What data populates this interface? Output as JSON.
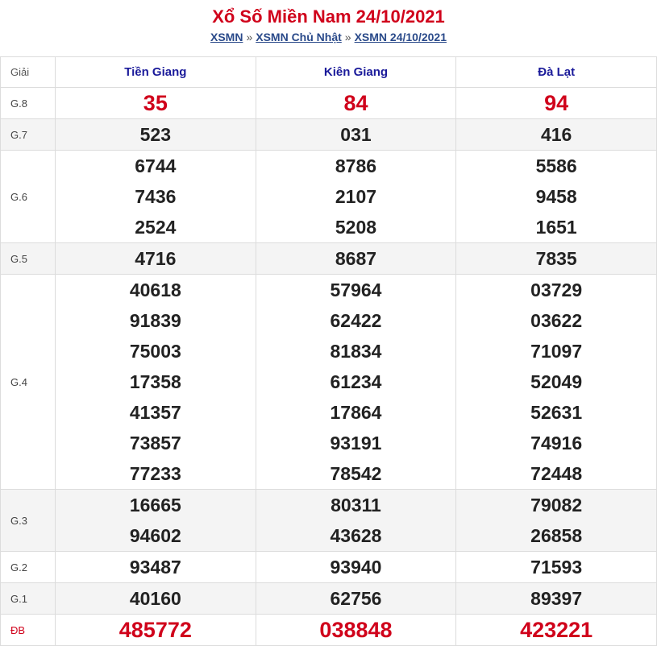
{
  "title": "Xổ Số Miền Nam 24/10/2021",
  "breadcrumb": {
    "items": [
      "XSMN",
      "XSMN Chủ Nhật",
      "XSMN 24/10/2021"
    ],
    "separator": "»"
  },
  "header": {
    "prize_col": "Giải",
    "provinces": [
      "Tiền Giang",
      "Kiên Giang",
      "Đà Lạt"
    ]
  },
  "rows": {
    "g8": {
      "label": "G.8",
      "values": [
        [
          "35"
        ],
        [
          "84"
        ],
        [
          "94"
        ]
      ]
    },
    "g7": {
      "label": "G.7",
      "values": [
        [
          "523"
        ],
        [
          "031"
        ],
        [
          "416"
        ]
      ]
    },
    "g6": {
      "label": "G.6",
      "values": [
        [
          "6744",
          "7436",
          "2524"
        ],
        [
          "8786",
          "2107",
          "5208"
        ],
        [
          "5586",
          "9458",
          "1651"
        ]
      ]
    },
    "g5": {
      "label": "G.5",
      "values": [
        [
          "4716"
        ],
        [
          "8687"
        ],
        [
          "7835"
        ]
      ]
    },
    "g4": {
      "label": "G.4",
      "values": [
        [
          "40618",
          "91839",
          "75003",
          "17358",
          "41357",
          "73857",
          "77233"
        ],
        [
          "57964",
          "62422",
          "81834",
          "61234",
          "17864",
          "93191",
          "78542"
        ],
        [
          "03729",
          "03622",
          "71097",
          "52049",
          "52631",
          "74916",
          "72448"
        ]
      ]
    },
    "g3": {
      "label": "G.3",
      "values": [
        [
          "16665",
          "94602"
        ],
        [
          "80311",
          "43628"
        ],
        [
          "79082",
          "26858"
        ]
      ]
    },
    "g2": {
      "label": "G.2",
      "values": [
        [
          "93487"
        ],
        [
          "93940"
        ],
        [
          "71593"
        ]
      ]
    },
    "g1": {
      "label": "G.1",
      "values": [
        [
          "40160"
        ],
        [
          "62756"
        ],
        [
          "89397"
        ]
      ]
    },
    "db": {
      "label": "ĐB",
      "values": [
        [
          "485772"
        ],
        [
          "038848"
        ],
        [
          "423221"
        ]
      ]
    }
  },
  "colors": {
    "accent_red": "#d0021b",
    "header_blue": "#1a1a9a",
    "link_blue": "#2a4a8a"
  }
}
